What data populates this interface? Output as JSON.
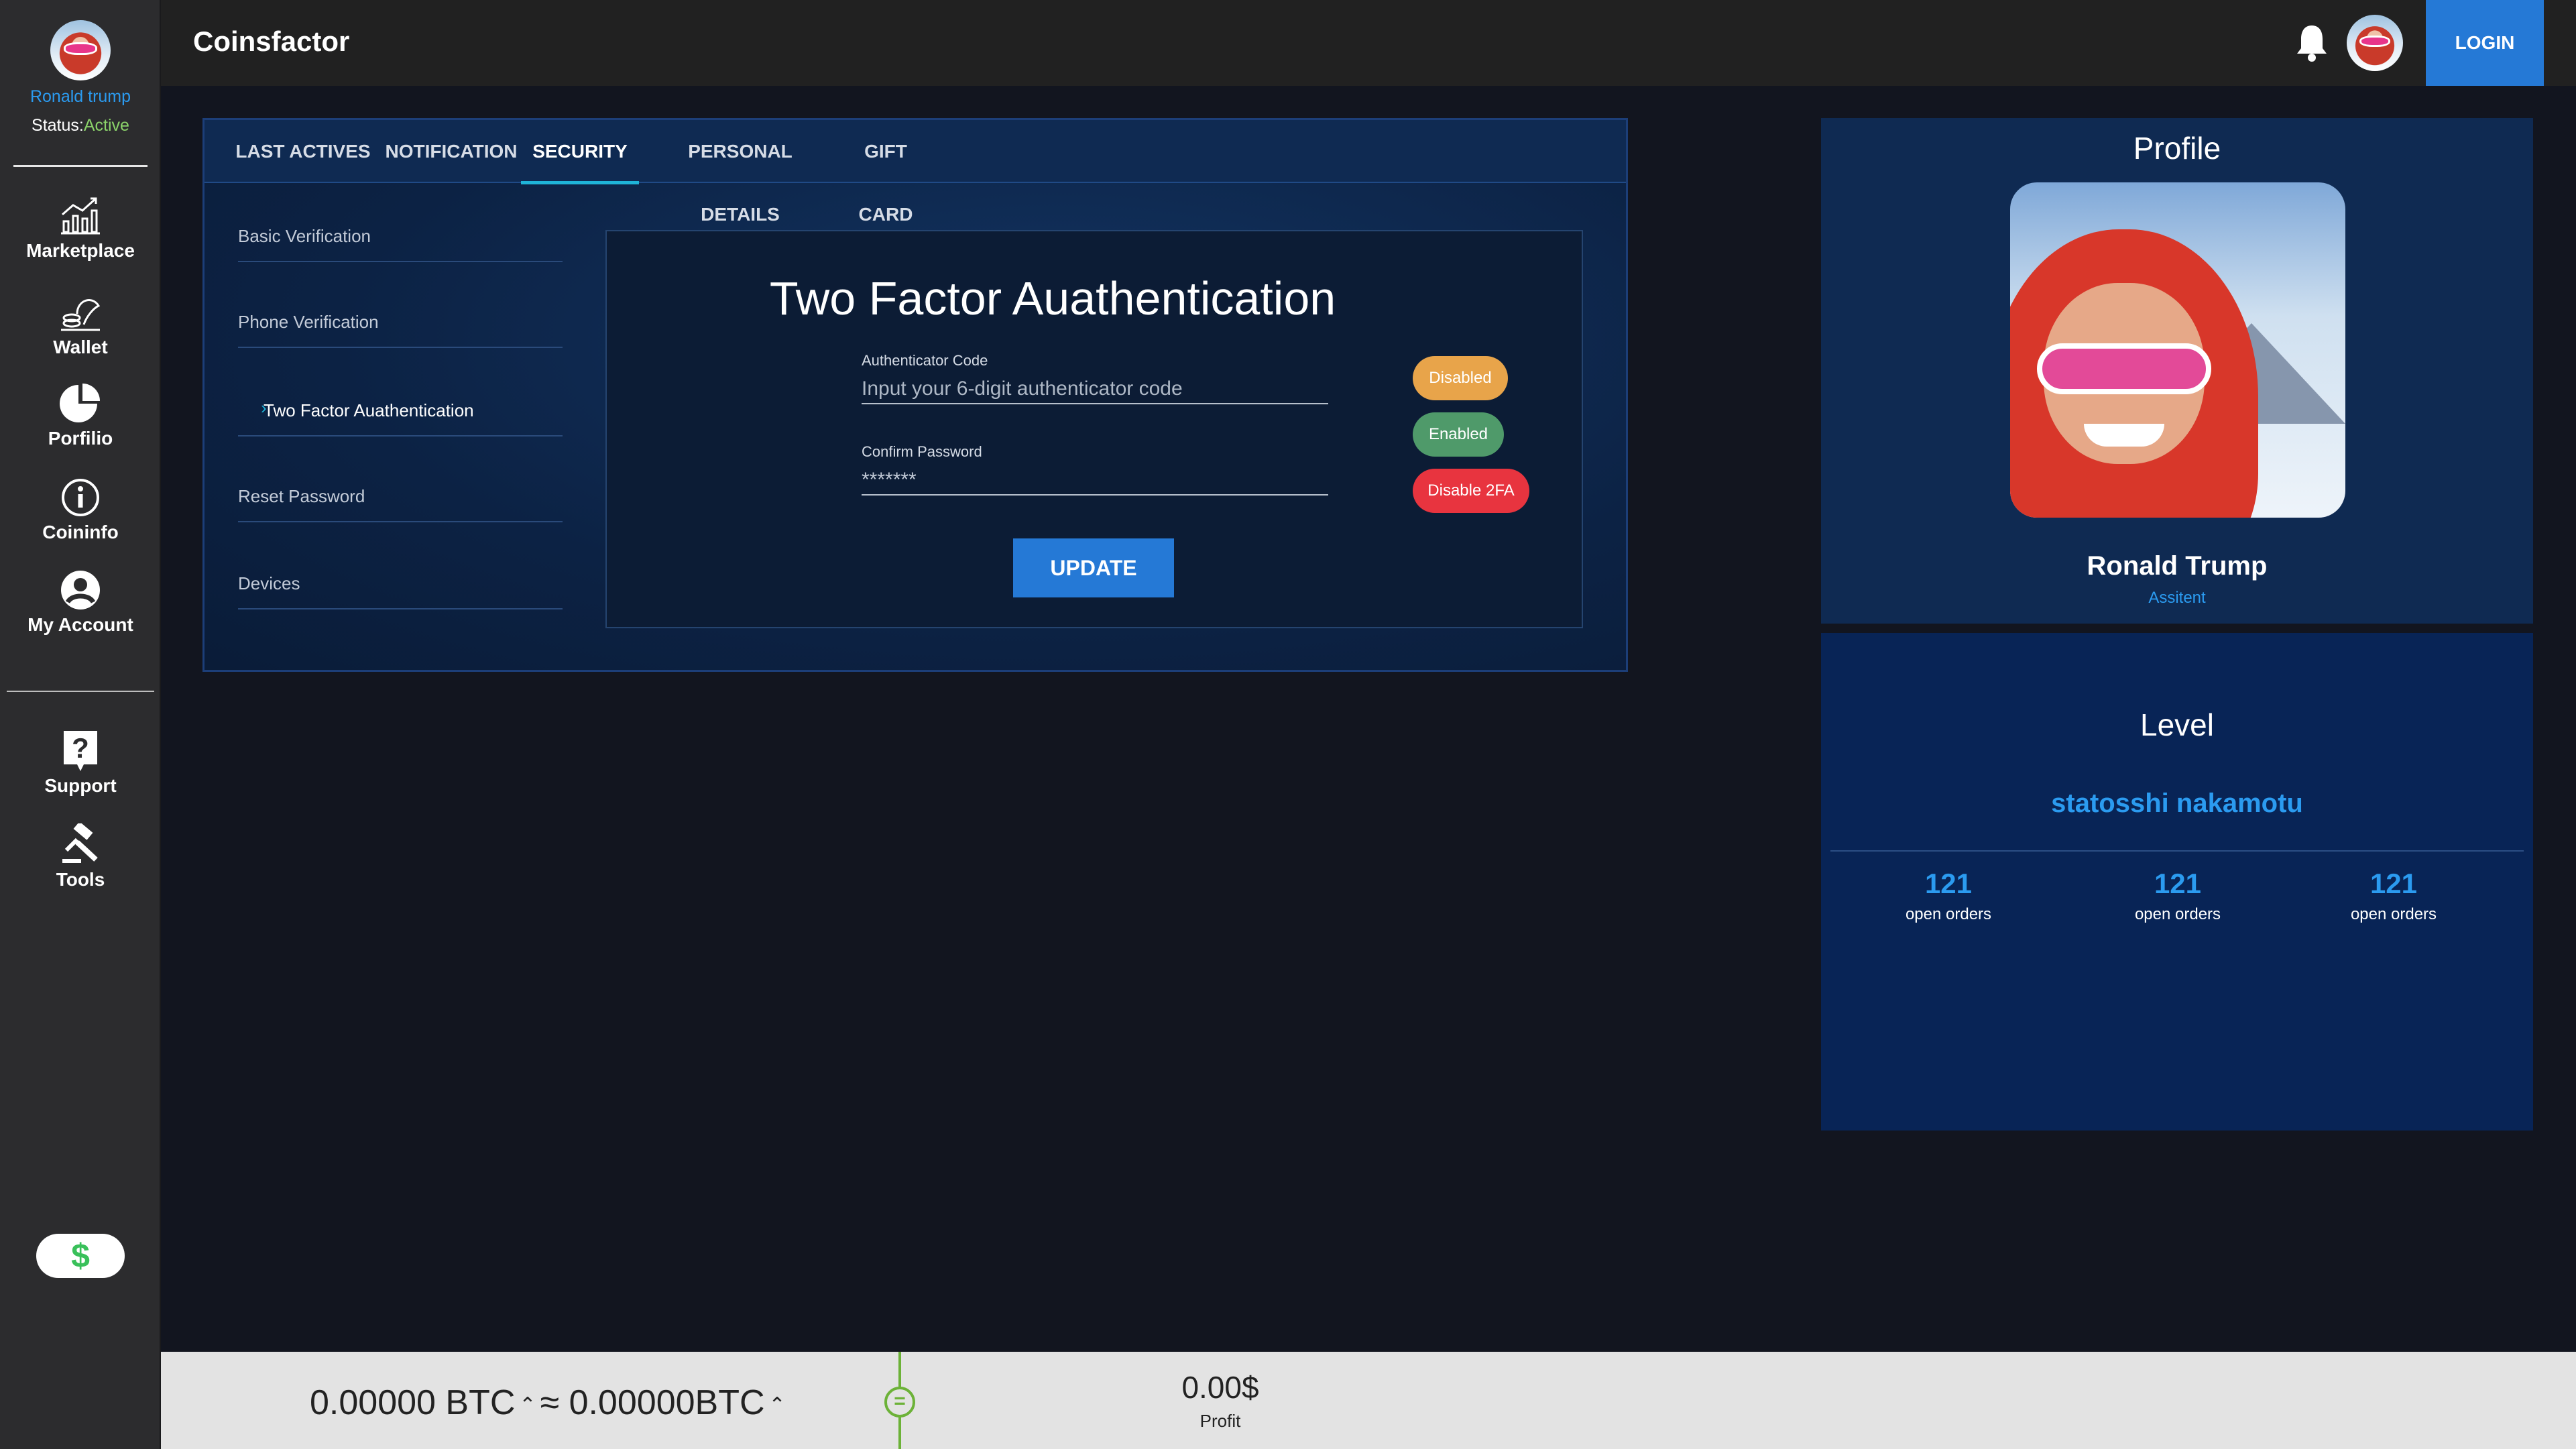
{
  "colors": {
    "accent": "#2579d6",
    "sidebar_bg": "#2c2c2e",
    "panel_bg": "#0f2a52",
    "highlight_blue": "#2b9bf0",
    "status_active": "#8bd36a",
    "pill_disabled": "#e8a44a",
    "pill_enabled": "#4f9a6a",
    "pill_disable_2fa": "#e8343f"
  },
  "sidebar": {
    "user_name": "Ronald trump",
    "status_label": "Status:",
    "status_value": "Active",
    "items": [
      {
        "label": "Marketplace",
        "icon": "chart-icon"
      },
      {
        "label": "Wallet",
        "icon": "wallet-icon"
      },
      {
        "label": "Porfilio",
        "icon": "pie-chart-icon"
      },
      {
        "label": "Coininfo",
        "icon": "info-icon"
      },
      {
        "label": "My Account",
        "icon": "user-icon"
      }
    ],
    "bottom_items": [
      {
        "label": "Support",
        "icon": "question-icon"
      },
      {
        "label": "Tools",
        "icon": "gavel-icon"
      }
    ],
    "dollar_toggle": "$"
  },
  "header": {
    "title": "Coinsfactor",
    "login_label": "LOGIN"
  },
  "security": {
    "tabs": [
      {
        "label": "LAST ACTIVES"
      },
      {
        "label": "NOTIFICATION"
      },
      {
        "label": "SECURITY"
      },
      {
        "label": "PERSONAL DETAILS"
      },
      {
        "label": "GIFT CARD"
      }
    ],
    "active_tab": "SECURITY",
    "side_menu": [
      {
        "label": "Basic Verification"
      },
      {
        "label": "Phone Verification"
      },
      {
        "label": "Two Factor Auathentication"
      },
      {
        "label": "Reset Password"
      },
      {
        "label": "Devices"
      }
    ],
    "active_side_item": "Two Factor Auathentication",
    "twofa": {
      "title": "Two Factor Auathentication",
      "auth_label": "Authenticator Code",
      "auth_placeholder": "Input your 6-digit authenticator code",
      "auth_value": "",
      "password_label": "Confirm Password",
      "password_value": "*******",
      "update_label": "UPDATE",
      "pill_disabled": "Disabled",
      "pill_enabled": "Enabled",
      "pill_disable_2fa": "Disable 2FA"
    }
  },
  "profile": {
    "title": "Profile",
    "name": "Ronald Trump",
    "role": "Assitent"
  },
  "level": {
    "title": "Level",
    "name": "statosshi nakamotu",
    "stats": [
      {
        "value": "121",
        "label": "open orders"
      },
      {
        "value": "121",
        "label": "open orders"
      },
      {
        "value": "121",
        "label": "open orders"
      }
    ]
  },
  "bottom": {
    "btc_left": "0.00000 BTC",
    "approx": "≈",
    "btc_right": "0.00000BTC",
    "caret": "⌃",
    "equals": "=",
    "profit_value": "0.00$",
    "profit_label": "Profit"
  }
}
